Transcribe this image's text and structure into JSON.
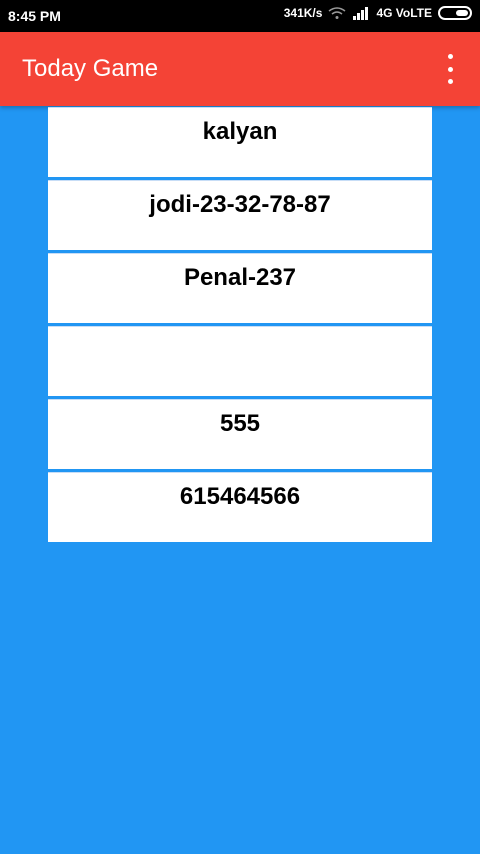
{
  "status_bar": {
    "time": "8:45 PM",
    "network_speed": "341K/s",
    "network_type": "4G VoLTE",
    "icons": [
      "wifi-icon",
      "signal-icon",
      "battery-icon"
    ]
  },
  "app_bar": {
    "title": "Today Game",
    "menu_icon": "overflow-menu-icon",
    "background": "#F44336"
  },
  "background": "#2196F3",
  "cards": [
    {
      "text": "kalyan"
    },
    {
      "text": "jodi-23-32-78-87"
    },
    {
      "text": "Penal-237"
    },
    {
      "text": ""
    },
    {
      "text": "555"
    },
    {
      "text": "615464566"
    }
  ]
}
